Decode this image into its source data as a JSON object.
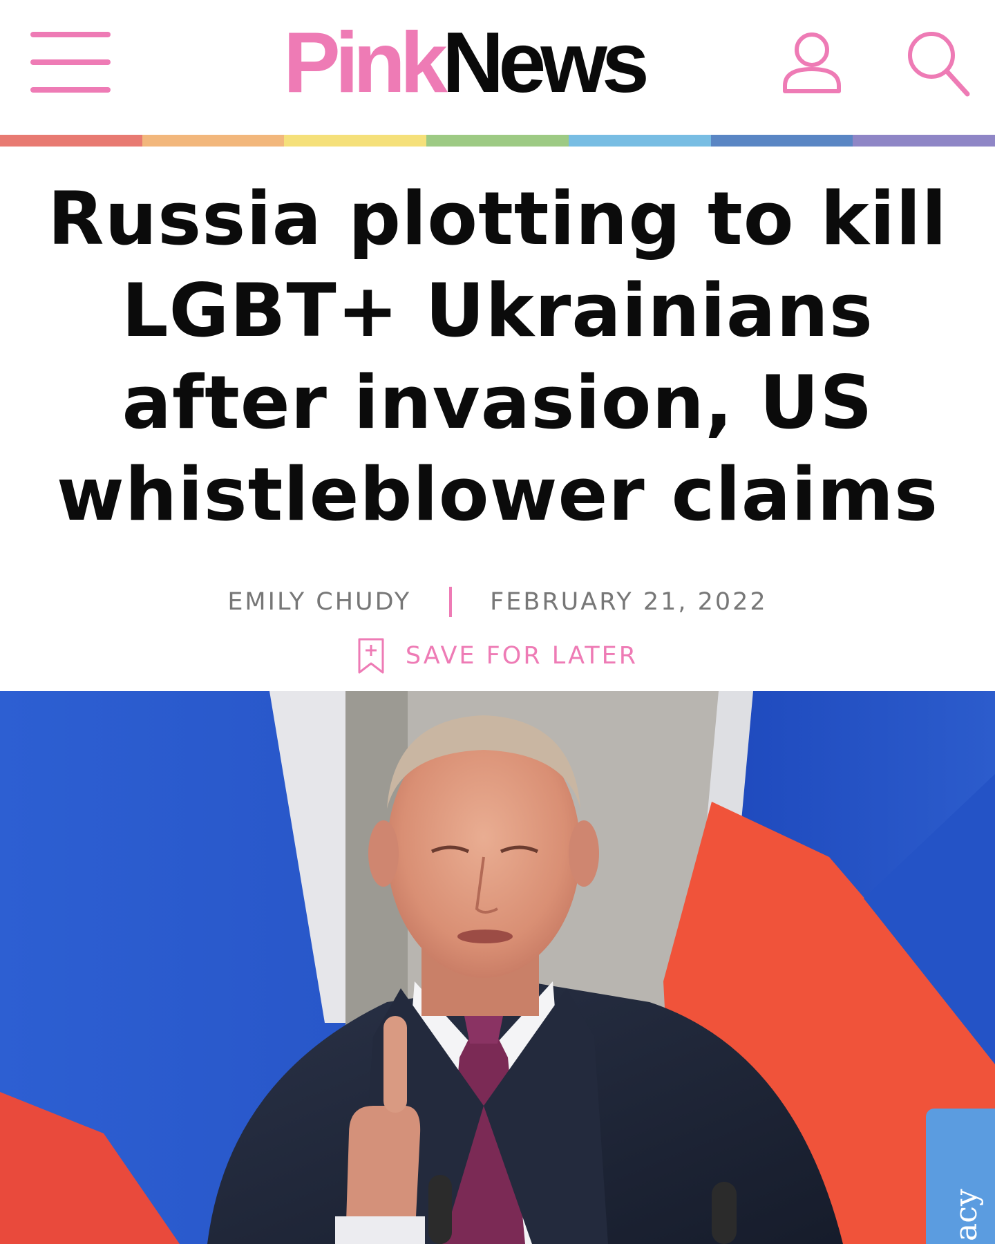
{
  "header": {
    "logo_pink": "Pink",
    "logo_news": "News",
    "menu_icon": "hamburger-menu-icon",
    "account_icon": "user-account-icon",
    "search_icon": "search-icon",
    "brand_color": "#ee7bb5",
    "rainbow_colors": [
      "#e87a72",
      "#f2b77c",
      "#f5e07a",
      "#9dca84",
      "#78bde3",
      "#5a86c4",
      "#8f86c6"
    ]
  },
  "article": {
    "headline": "Russia plotting to kill LGBT+ Ukrainians after invasion, US whistleblower claims",
    "author": "EMILY CHUDY",
    "date": "FEBRUARY 21, 2022",
    "save_label": "SAVE FOR LATER",
    "save_icon": "bookmark-add-icon"
  },
  "privacy_tab": {
    "label": "acy"
  }
}
